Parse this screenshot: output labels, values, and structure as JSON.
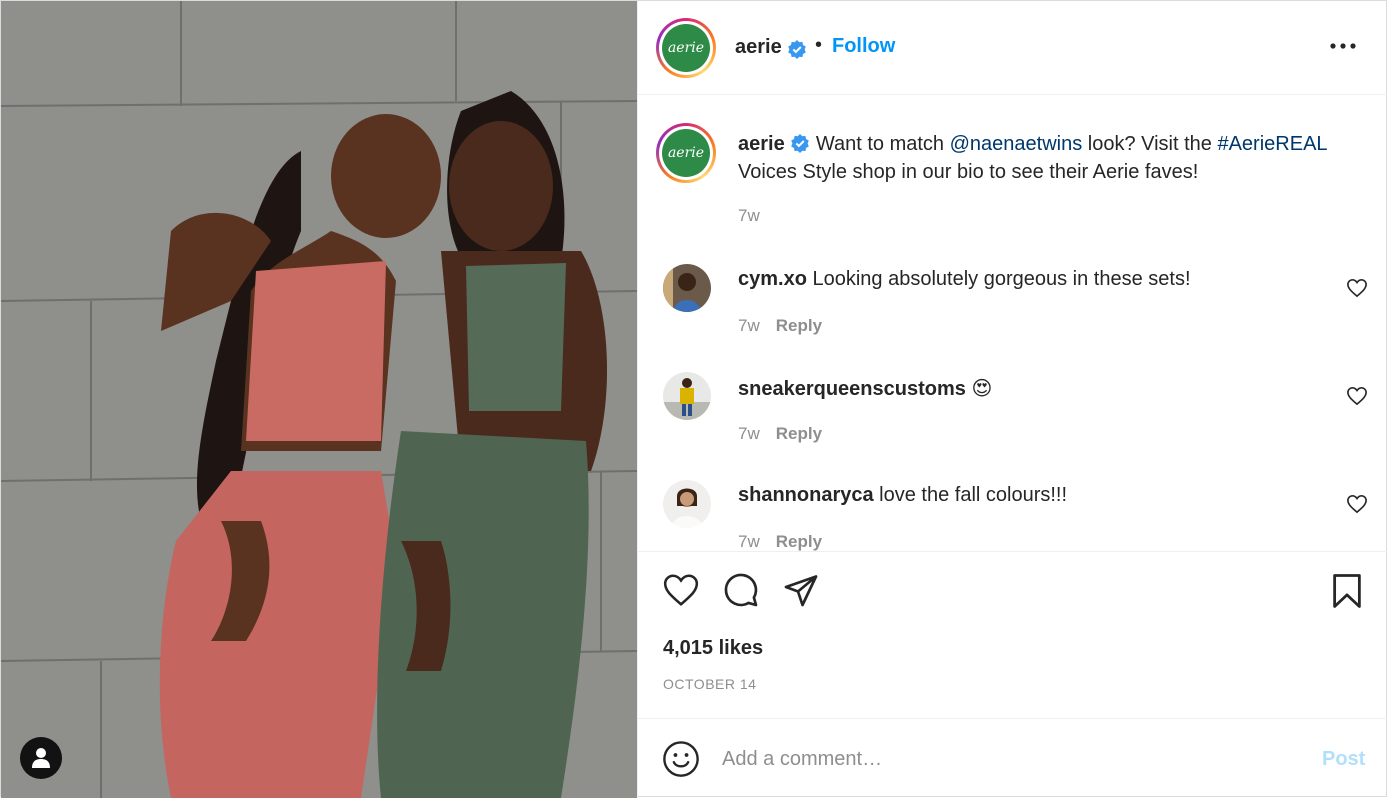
{
  "header": {
    "username": "aerie",
    "separator": "•",
    "follow_label": "Follow",
    "avatar_text": "aerie",
    "icons": {
      "verified": "verified-badge-icon",
      "more": "more-options-icon"
    }
  },
  "caption": {
    "username": "aerie",
    "text_before": " Want to match ",
    "mention": "@naenaetwins",
    "text_middle": " look? Visit the ",
    "hashtag": "#AerieREAL",
    "text_after": " Voices Style shop in our bio to see their Aerie faves!",
    "time": "7w"
  },
  "comments": [
    {
      "username": "cym.xo",
      "text": " Looking absolutely gorgeous in these sets!",
      "time": "7w",
      "reply_label": "Reply"
    },
    {
      "username": "sneakerqueenscustoms",
      "text": " 😍",
      "time": "7w",
      "reply_label": "Reply"
    },
    {
      "username": "shannonaryca",
      "text": " love the fall colours!!!",
      "time": "7w",
      "reply_label": "Reply"
    }
  ],
  "actions": {
    "icons": [
      "heart-icon",
      "comment-icon",
      "share-icon",
      "bookmark-icon"
    ],
    "likes": "4,015 likes",
    "date": "OCTOBER 14"
  },
  "add_comment": {
    "placeholder": "Add a comment…",
    "post_label": "Post",
    "icon": "emoji-icon"
  },
  "colors": {
    "accent": "#0095f6",
    "link": "#00376b",
    "muted": "#8e8e8e",
    "post_disabled": "#b2dffc",
    "brand_green": "#2e8b47"
  }
}
